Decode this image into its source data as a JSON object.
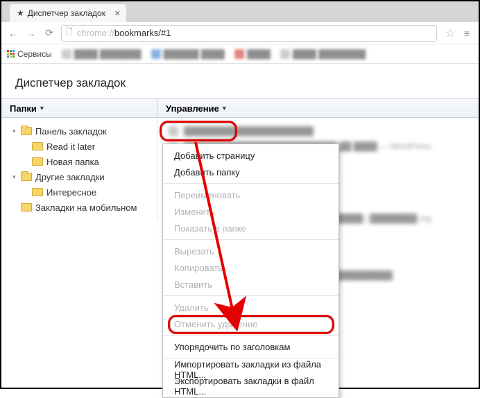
{
  "tab": {
    "title": "Диспетчер закладок"
  },
  "omnibox": {
    "url_light": "chrome://",
    "url_dark": "bookmarks/#1"
  },
  "bookmarks_bar": {
    "apps_label": "Сервисы"
  },
  "page": {
    "title": "Диспетчер закладок"
  },
  "columns": {
    "folders": "Папки",
    "manage": "Управление"
  },
  "tree": {
    "panel": "Панель закладок",
    "read_later": "Read it later",
    "new_folder": "Новая папка",
    "other": "Другие закладки",
    "interesting": "Интересное",
    "mobile": "Закладки на мобильном"
  },
  "menu": {
    "add_page": "Добавить страницу",
    "add_folder": "Добавить папку",
    "rename": "Переименовать",
    "edit": "Изменить",
    "show_in_folder": "Показать в папке",
    "cut": "Вырезать",
    "copy": "Копировать",
    "paste": "Вставить",
    "delete": "Удалить",
    "undo_delete": "Отменить удаление",
    "sort": "Упорядочить по заголовкам",
    "import_html": "Импортировать закладки из файла HTML...",
    "export_html": "Экспортировать закладки в файл HTML..."
  }
}
